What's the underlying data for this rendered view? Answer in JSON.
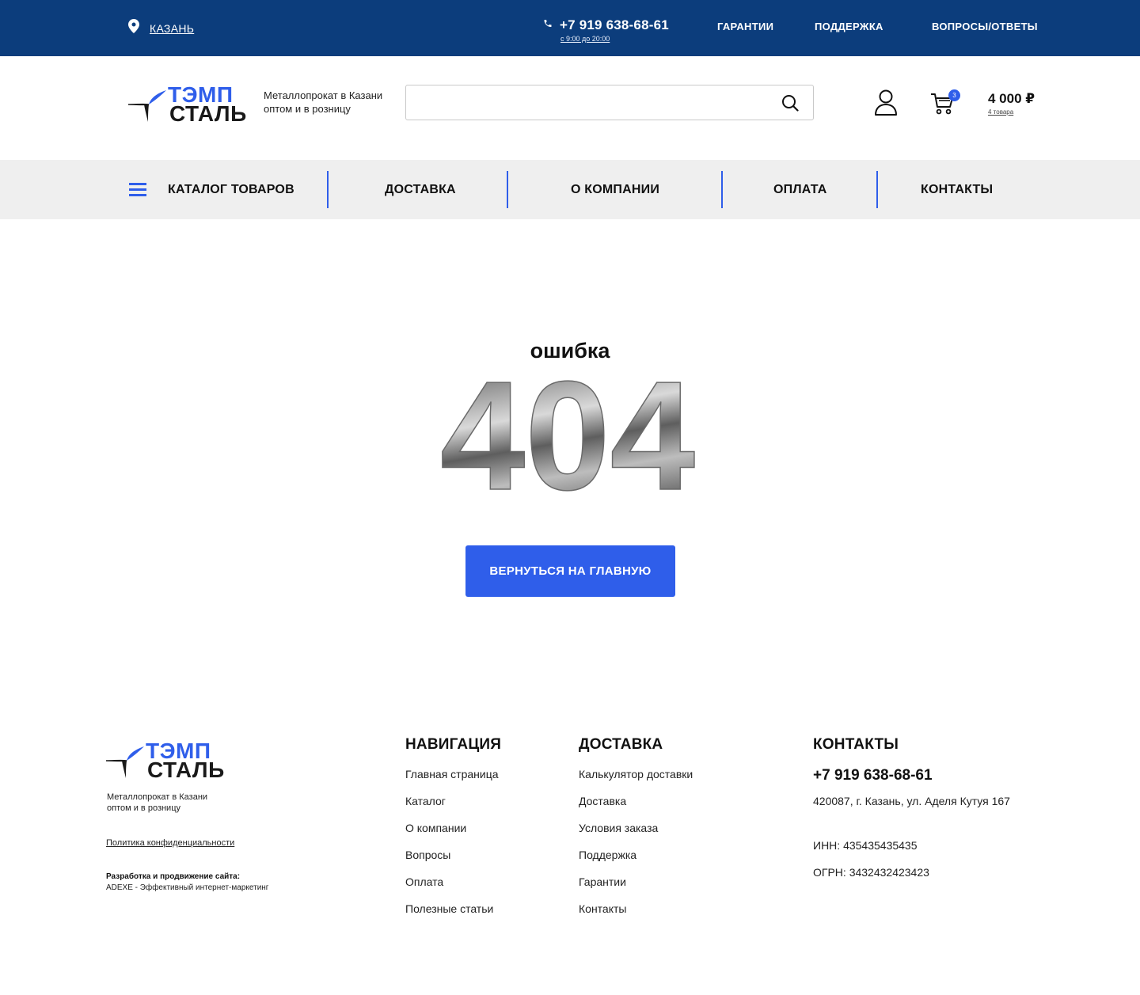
{
  "topbar": {
    "city": "КАЗАНЬ",
    "phone": "+7 919 638-68-61",
    "hours": "с 9:00 до 20:00",
    "links": [
      "ГАРАНТИИ",
      "ПОДДЕРЖКА",
      "ВОПРОСЫ/ОТВЕТЫ"
    ]
  },
  "header": {
    "logo_line1": "ТЭМП",
    "logo_line2": "СТАЛЬ",
    "tagline_line1": "Металлопрокат в Казани",
    "tagline_line2": "оптом и в розницу",
    "search_placeholder": "",
    "cart_badge": "3",
    "cart_total": "4 000 ₽",
    "cart_items": "4 товара"
  },
  "nav": {
    "items": [
      "КАТАЛОГ ТОВАРОВ",
      "ДОСТАВКА",
      "О КОМПАНИИ",
      "ОПЛАТА",
      "КОНТАКТЫ"
    ]
  },
  "error": {
    "label": "ошибка",
    "code": "404",
    "button": "ВЕРНУТЬСЯ НА ГЛАВНУЮ"
  },
  "footer": {
    "logo_line1": "ТЭМП",
    "logo_line2": "СТАЛЬ",
    "tagline_line1": "Металлопрокат в Казани",
    "tagline_line2": "оптом и в розницу",
    "policy": "Политика конфиденциальности",
    "dev_title": "Разработка и продвижение сайта:",
    "dev_text": "ADEXE - Эффективный интернет-маркетинг",
    "navigation": {
      "title": "НАВИГАЦИЯ",
      "items": [
        "Главная страница",
        "Каталог",
        "О компании",
        "Вопросы",
        "Оплата",
        "Полезные статьи"
      ]
    },
    "delivery": {
      "title": "ДОСТАВКА",
      "items": [
        "Калькулятор доставки",
        "Доставка",
        "Условия заказа",
        "Поддержка",
        "Гарантии",
        "Контакты"
      ]
    },
    "contacts": {
      "title": "КОНТАКТЫ",
      "phone": "+7 919 638-68-61",
      "address": "420087,  г. Казань, ул. Аделя Кутуя 167",
      "inn": "ИНН: 435435435435",
      "ogrn": "ОГРН: 3432432423423"
    }
  },
  "colors": {
    "topbar": "#0c3d7c",
    "accent": "#2f5eea",
    "nav_bg": "#efefef"
  },
  "icons": [
    "location-pin-icon",
    "phone-icon",
    "logo-star-icon",
    "search-icon",
    "user-icon",
    "cart-icon",
    "menu-icon"
  ]
}
